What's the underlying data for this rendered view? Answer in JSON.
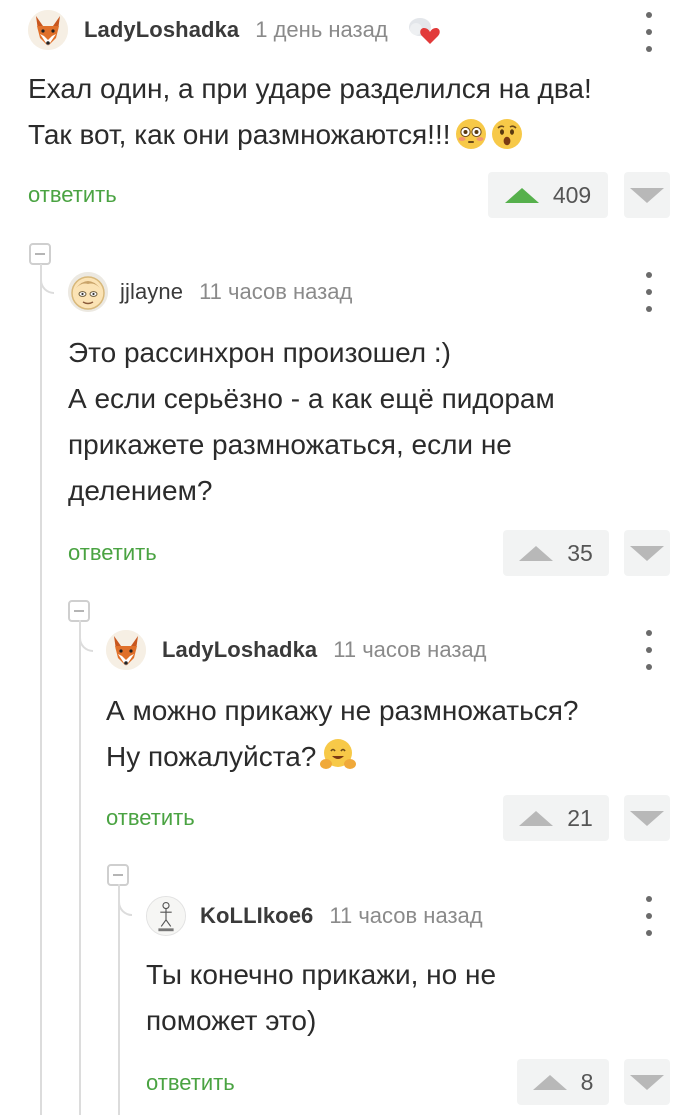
{
  "comments": [
    {
      "author": "LadyLoshadka",
      "time": "1 день назад",
      "avatar_icon": "fox-avatar-icon",
      "badge_icon": "heart-badge-icon",
      "lines": [
        "Ехал один, а при ударе разделился на два!",
        "Так вот, как они размножаются!!!"
      ],
      "emojis": [
        "flushed-face-emoji",
        "astonished-face-emoji"
      ],
      "reply_label": "ответить",
      "rating": "409",
      "upvoted": true
    },
    {
      "author": "jjlayne",
      "time": "11 часов назад",
      "avatar_icon": "cartoon-face-avatar-icon",
      "lines": [
        "Это рассинхрон произошел :)",
        "А если серьёзно - а как ещё пидорам",
        "прикажете размножаться, если не",
        "делением?"
      ],
      "reply_label": "ответить",
      "rating": "35",
      "upvoted": false
    },
    {
      "author": "LadyLoshadka",
      "time": "11 часов назад",
      "avatar_icon": "fox-avatar-icon",
      "lines": [
        "А можно прикажу не размножаться?",
        "Ну пожалуйста?"
      ],
      "emojis": [
        "hugging-face-emoji"
      ],
      "reply_label": "ответить",
      "rating": "21",
      "upvoted": false
    },
    {
      "author": "KoLLIkoe6",
      "time": "11 часов назад",
      "avatar_icon": "sketch-figure-avatar-icon",
      "lines": [
        "Ты конечно прикажи, но не",
        "поможет это)"
      ],
      "reply_label": "ответить",
      "rating": "8",
      "upvoted": false
    }
  ],
  "colors": {
    "reply_green": "#4aa342",
    "upvote_active": "#56b04c",
    "vote_bg": "#f2f3f3",
    "thread_line": "#dcdcdc"
  }
}
